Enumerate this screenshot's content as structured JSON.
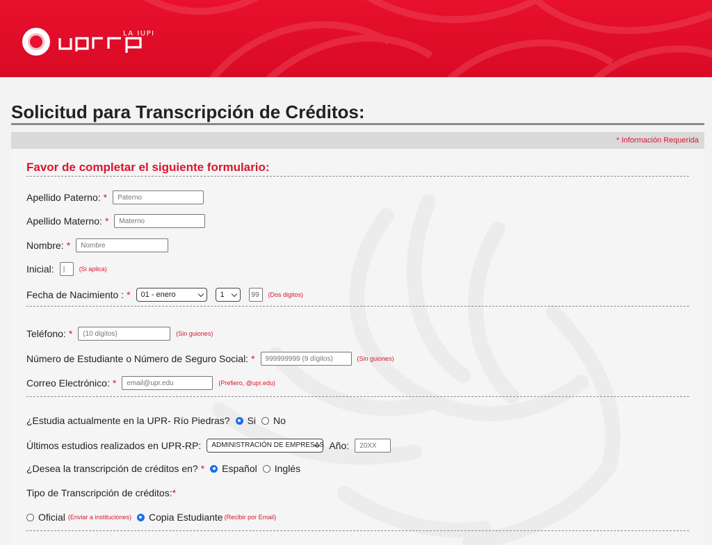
{
  "header": {
    "logo_text": "upr rp",
    "logo_superscript": "LA IUPI"
  },
  "page_title": "Solicitud para Transcripción de Créditos:",
  "required_note": "* Información Requerida",
  "form_heading": "Favor de completar el siguiente formulario:",
  "fields": {
    "paterno": {
      "label": "Apellido Paterno:",
      "placeholder": "Paterno"
    },
    "materno": {
      "label": "Apellido Materno:",
      "placeholder": "Materno"
    },
    "nombre": {
      "label": "Nombre:",
      "placeholder": "Nombre"
    },
    "inicial": {
      "label": "Inicial:",
      "value": "|",
      "hint": "(Si aplica)"
    },
    "nacimiento": {
      "label": "Fecha de Nacimiento :",
      "month_value": "01 - enero",
      "day_value": "1",
      "year_value": "99",
      "hint": "(Dos digitos)"
    },
    "telefono": {
      "label": "Teléfono:",
      "placeholder": "(10 digitos)",
      "hint": "(Sin guiones)"
    },
    "estudiante": {
      "label": "Número de Estudiante o Número de Seguro Social:",
      "placeholder": "999999999 (9 dígitos)",
      "hint": "(Sin guiones)"
    },
    "correo": {
      "label": "Correo Electrónico:",
      "placeholder": "email@upr.edu",
      "hint": "(Prefiero, @upr.edu)"
    },
    "estudia": {
      "label": "¿Estudia actualmente en la UPR- Río Piedras?",
      "opt_si": "Si",
      "opt_no": "No",
      "selected": "Si"
    },
    "ultimos": {
      "label": "Últimos estudios realizados en UPR-RP:",
      "select_value": "ADMINISTRACIÓN DE EMPRESAS",
      "anio_label": "Año:",
      "anio_placeholder": "20XX"
    },
    "idioma": {
      "label": "¿Desea la transcripción de créditos en?",
      "opt_es": "Español",
      "opt_en": "Inglés",
      "selected": "Español"
    },
    "tipo": {
      "label": "Tipo de Transcripción de créditos:",
      "opt_oficial": "Oficial",
      "hint_oficial": "(Enviar a instituciones)",
      "opt_copia": "Copia Estudiante",
      "hint_copia": "(Recibir por Email)",
      "selected": "Copia Estudiante"
    },
    "required_star": "*"
  },
  "colors": {
    "brand_red": "#e8102d",
    "required_red": "#d8152e",
    "radio_blue": "#1a6ee8"
  }
}
